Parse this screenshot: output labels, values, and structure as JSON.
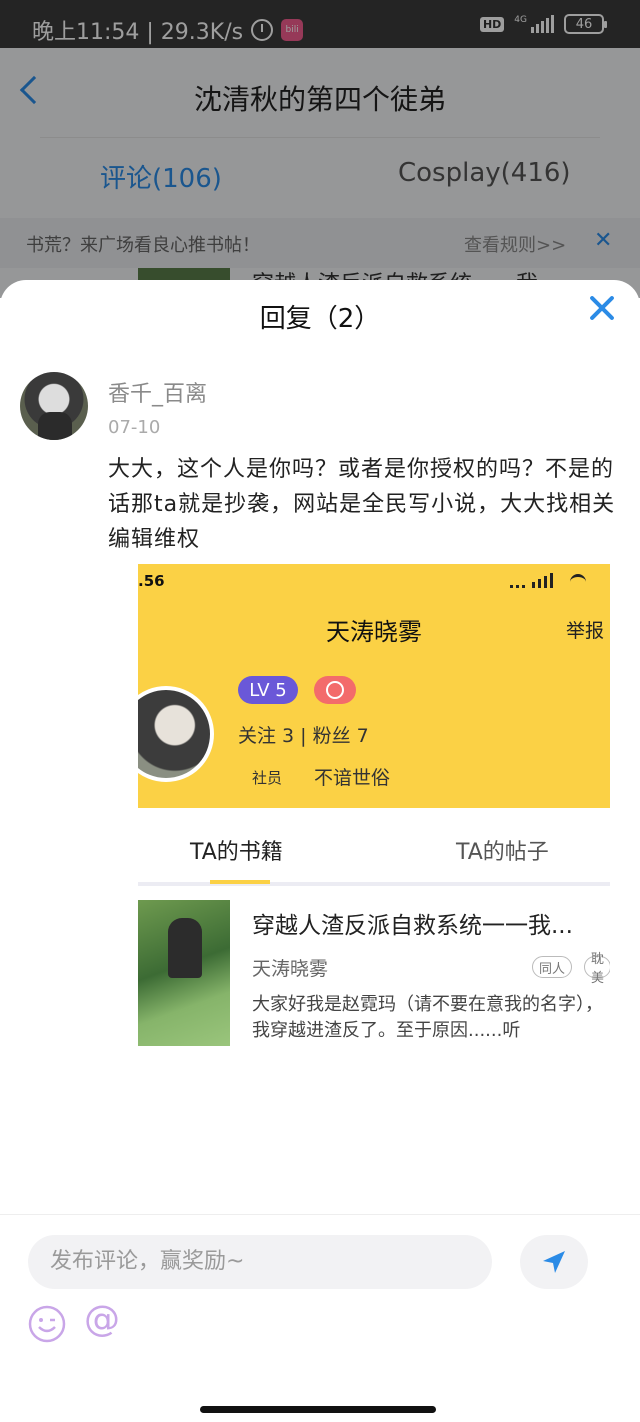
{
  "status_bar": {
    "time_speed": "晚上11:54 | 29.3K/s",
    "app_icon_text": "bili",
    "hd": "HD",
    "network": "4G",
    "battery": "46"
  },
  "background_page": {
    "title": "沈清秋的第四个徒弟",
    "tab_comments": "评论(106)",
    "tab_cosplay": "Cosplay(416)",
    "notice_text": "书荒？来广场看良心推书帖！",
    "notice_rules": "查看规则>>",
    "notice_close": "✕",
    "peek_text": "穿越人渣反派自救系统一一我"
  },
  "reply_sheet": {
    "title": "回复（2）",
    "comment": {
      "username": "香千_百离",
      "date": "07-10",
      "text": "大大，这个人是你吗？或者是你授权的吗？不是的话那ta就是抄袭，网站是全民写小说，大大找相关编辑维权"
    },
    "attached_screenshot": {
      "time": ".56",
      "profile_name": "天涛晓雾",
      "report": "举报",
      "level": "LV 5",
      "follow_stats": "关注  3  |  粉丝  7",
      "member_label": "社员",
      "member_value": "不谙世俗",
      "tab_books": "TA的书籍",
      "tab_posts": "TA的帖子",
      "book": {
        "title": "穿越人渣反派自救系统一一我...",
        "author": "天涛晓雾",
        "tags": [
          "同人",
          "耽美"
        ],
        "description": "大家好我是赵霓玛（请不要在意我的名字），我穿越进渣反了。至于原因......听"
      }
    }
  },
  "composer": {
    "placeholder": "发布评论，赢奖励~",
    "at_symbol": "@"
  },
  "colors": {
    "accent": "#2b8be6",
    "profile_yellow": "#fbd145",
    "level_purple": "#6a58d8"
  }
}
